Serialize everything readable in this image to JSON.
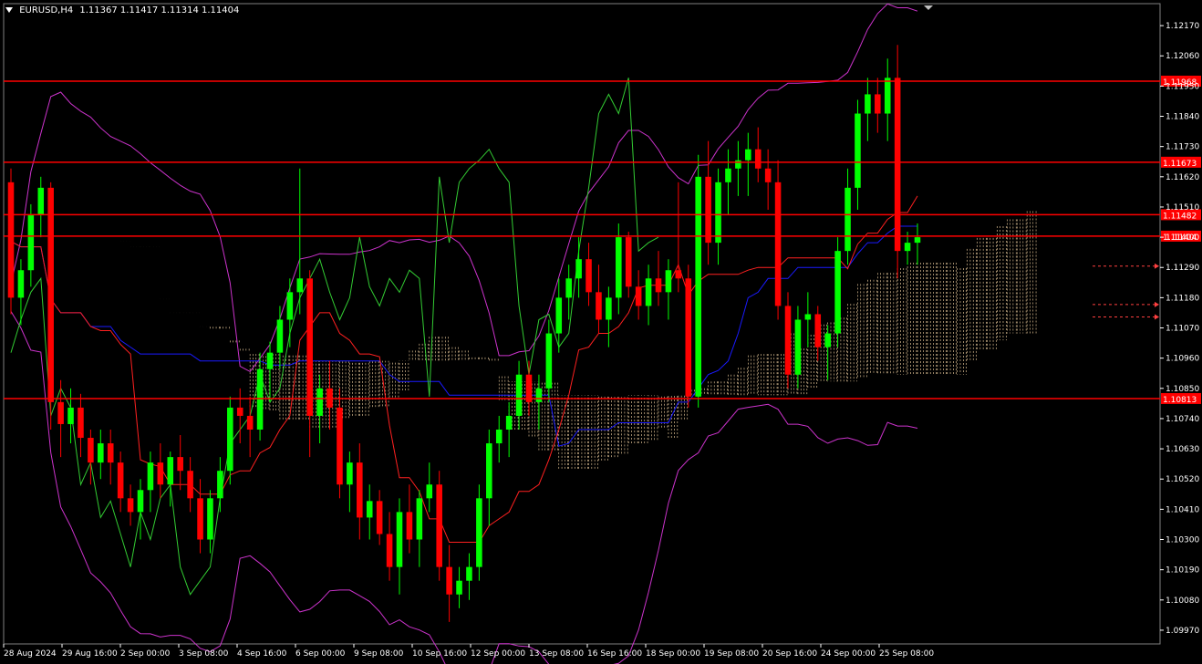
{
  "symbol_header": {
    "symbol": "EURUSD,H4",
    "ohlc": "1.11367 1.11417 1.11314 1.11404"
  },
  "colors": {
    "background": "#000000",
    "bull": "#00ff00",
    "bear": "#ff0000",
    "hline": "#ff0000",
    "price_tag_bg": "#ff0000",
    "axis": "#ffffff",
    "bollinger": "#cc33cc",
    "tenkan": "#ff2020",
    "kijun": "#1a1aff",
    "chikou": "#33cc33",
    "cloud": "#ffddaa"
  },
  "chart_data": {
    "type": "candlestick",
    "symbol": "EURUSD",
    "timeframe": "H4",
    "ylim": [
      1.0992,
      1.1225
    ],
    "y_ticks": [
      "1.12170",
      "1.12060",
      "1.11950",
      "1.11840",
      "1.11730",
      "1.11620",
      "1.11510",
      "1.11400",
      "1.11290",
      "1.11180",
      "1.11070",
      "1.10960",
      "1.10850",
      "1.10740",
      "1.10630",
      "1.10520",
      "1.10410",
      "1.10300",
      "1.10190",
      "1.10080",
      "1.09970"
    ],
    "x_ticks": [
      "28 Aug 2024",
      "29 Aug 16:00",
      "2 Sep 00:00",
      "3 Sep 08:00",
      "4 Sep 16:00",
      "6 Sep 00:00",
      "9 Sep 08:00",
      "10 Sep 16:00",
      "12 Sep 00:00",
      "13 Sep 08:00",
      "16 Sep 16:00",
      "18 Sep 00:00",
      "19 Sep 08:00",
      "20 Sep 16:00",
      "24 Sep 00:00",
      "25 Sep 08:00"
    ],
    "horizontal_levels": [
      {
        "price": 1.11968,
        "label": "1.11968"
      },
      {
        "price": 1.11673,
        "label": "1.11673"
      },
      {
        "price": 1.11482,
        "label": "1.11482"
      },
      {
        "price": 1.11404,
        "label": "1.11404"
      },
      {
        "price": 1.10813,
        "label": "1.10813"
      }
    ],
    "candles": [
      [
        1.116,
        1.1165,
        1.1112,
        1.1118
      ],
      [
        1.1118,
        1.1132,
        1.1108,
        1.1128
      ],
      [
        1.1128,
        1.1152,
        1.1122,
        1.1148
      ],
      [
        1.1148,
        1.1162,
        1.114,
        1.1158
      ],
      [
        1.1158,
        1.116,
        1.107,
        1.108
      ],
      [
        1.108,
        1.1088,
        1.106,
        1.1072
      ],
      [
        1.1072,
        1.1085,
        1.1065,
        1.1078
      ],
      [
        1.1078,
        1.1083,
        1.106,
        1.1067
      ],
      [
        1.1067,
        1.107,
        1.105,
        1.1058
      ],
      [
        1.1058,
        1.107,
        1.1052,
        1.1065
      ],
      [
        1.1065,
        1.107,
        1.105,
        1.1058
      ],
      [
        1.1058,
        1.1062,
        1.104,
        1.1045
      ],
      [
        1.1045,
        1.105,
        1.1035,
        1.104
      ],
      [
        1.104,
        1.1052,
        1.103,
        1.1048
      ],
      [
        1.1048,
        1.1062,
        1.104,
        1.1058
      ],
      [
        1.1058,
        1.1065,
        1.1045,
        1.105
      ],
      [
        1.105,
        1.1062,
        1.1042,
        1.106
      ],
      [
        1.106,
        1.1068,
        1.1048,
        1.1055
      ],
      [
        1.1055,
        1.106,
        1.104,
        1.1045
      ],
      [
        1.1045,
        1.1052,
        1.1025,
        1.103
      ],
      [
        1.103,
        1.1048,
        1.1025,
        1.1045
      ],
      [
        1.1045,
        1.106,
        1.104,
        1.1055
      ],
      [
        1.1055,
        1.1082,
        1.105,
        1.1078
      ],
      [
        1.1078,
        1.1085,
        1.1065,
        1.1075
      ],
      [
        1.1075,
        1.1082,
        1.106,
        1.107
      ],
      [
        1.107,
        1.1098,
        1.1066,
        1.1092
      ],
      [
        1.1092,
        1.1102,
        1.108,
        1.1098
      ],
      [
        1.1098,
        1.1115,
        1.1092,
        1.111
      ],
      [
        1.111,
        1.1125,
        1.11,
        1.112
      ],
      [
        1.112,
        1.1165,
        1.1112,
        1.1125
      ],
      [
        1.1125,
        1.1128,
        1.106,
        1.1075
      ],
      [
        1.1075,
        1.109,
        1.1065,
        1.1085
      ],
      [
        1.1085,
        1.1095,
        1.107,
        1.1078
      ],
      [
        1.1078,
        1.1085,
        1.1045,
        1.105
      ],
      [
        1.105,
        1.1062,
        1.104,
        1.1058
      ],
      [
        1.1058,
        1.1065,
        1.103,
        1.1038
      ],
      [
        1.1038,
        1.105,
        1.103,
        1.1044
      ],
      [
        1.1044,
        1.1048,
        1.1028,
        1.1032
      ],
      [
        1.1032,
        1.104,
        1.1015,
        1.102
      ],
      [
        1.102,
        1.1045,
        1.101,
        1.104
      ],
      [
        1.104,
        1.105,
        1.1025,
        1.103
      ],
      [
        1.103,
        1.1048,
        1.102,
        1.1045
      ],
      [
        1.1045,
        1.1058,
        1.104,
        1.105
      ],
      [
        1.105,
        1.1055,
        1.1015,
        1.102
      ],
      [
        1.102,
        1.1028,
        1.1,
        1.101
      ],
      [
        1.101,
        1.102,
        1.1005,
        1.1015
      ],
      [
        1.1015,
        1.1025,
        1.1008,
        1.102
      ],
      [
        1.102,
        1.105,
        1.1015,
        1.1045
      ],
      [
        1.1045,
        1.107,
        1.1035,
        1.1065
      ],
      [
        1.1065,
        1.1075,
        1.1058,
        1.107
      ],
      [
        1.107,
        1.108,
        1.106,
        1.1075
      ],
      [
        1.1075,
        1.1095,
        1.107,
        1.109
      ],
      [
        1.109,
        1.1095,
        1.1075,
        1.108
      ],
      [
        1.108,
        1.109,
        1.107,
        1.1085
      ],
      [
        1.1085,
        1.111,
        1.108,
        1.1105
      ],
      [
        1.1105,
        1.1125,
        1.1098,
        1.1118
      ],
      [
        1.1118,
        1.113,
        1.111,
        1.1125
      ],
      [
        1.1125,
        1.114,
        1.1118,
        1.1132
      ],
      [
        1.1132,
        1.1138,
        1.1115,
        1.112
      ],
      [
        1.112,
        1.113,
        1.1105,
        1.111
      ],
      [
        1.111,
        1.1122,
        1.11,
        1.1118
      ],
      [
        1.1118,
        1.1145,
        1.1112,
        1.114
      ],
      [
        1.114,
        1.1142,
        1.1118,
        1.1122
      ],
      [
        1.1122,
        1.1128,
        1.111,
        1.1115
      ],
      [
        1.1115,
        1.113,
        1.1108,
        1.1125
      ],
      [
        1.1125,
        1.1135,
        1.1115,
        1.112
      ],
      [
        1.112,
        1.1132,
        1.111,
        1.1128
      ],
      [
        1.1128,
        1.116,
        1.112,
        1.1125
      ],
      [
        1.1125,
        1.113,
        1.1078,
        1.1082
      ],
      [
        1.1082,
        1.117,
        1.1078,
        1.1162
      ],
      [
        1.1162,
        1.1175,
        1.113,
        1.1138
      ],
      [
        1.1138,
        1.1165,
        1.113,
        1.116
      ],
      [
        1.116,
        1.1172,
        1.1148,
        1.1165
      ],
      [
        1.1165,
        1.1175,
        1.1155,
        1.1168
      ],
      [
        1.1168,
        1.1178,
        1.1155,
        1.1172
      ],
      [
        1.1172,
        1.118,
        1.116,
        1.1165
      ],
      [
        1.1165,
        1.1172,
        1.115,
        1.116
      ],
      [
        1.116,
        1.1168,
        1.111,
        1.1115
      ],
      [
        1.1115,
        1.112,
        1.1085,
        1.109
      ],
      [
        1.109,
        1.1115,
        1.1085,
        1.111
      ],
      [
        1.111,
        1.112,
        1.11,
        1.1112
      ],
      [
        1.1112,
        1.1115,
        1.1095,
        1.11
      ],
      [
        1.11,
        1.1108,
        1.1088,
        1.1105
      ],
      [
        1.1105,
        1.114,
        1.11,
        1.1135
      ],
      [
        1.1135,
        1.1165,
        1.113,
        1.1158
      ],
      [
        1.1158,
        1.119,
        1.115,
        1.1185
      ],
      [
        1.1185,
        1.1198,
        1.1175,
        1.1192
      ],
      [
        1.1192,
        1.1198,
        1.1178,
        1.1185
      ],
      [
        1.1185,
        1.1205,
        1.1175,
        1.1198
      ],
      [
        1.1198,
        1.121,
        1.1125,
        1.1135
      ],
      [
        1.1135,
        1.1142,
        1.113,
        1.1138
      ],
      [
        1.1138,
        1.1145,
        1.113,
        1.114
      ]
    ],
    "indicators": {
      "bollinger": "magenta",
      "ichimoku_tenkan": "red",
      "ichimoku_kijun": "blue",
      "ichimoku_chikou": "green",
      "ichimoku_cloud": "dotted"
    }
  }
}
